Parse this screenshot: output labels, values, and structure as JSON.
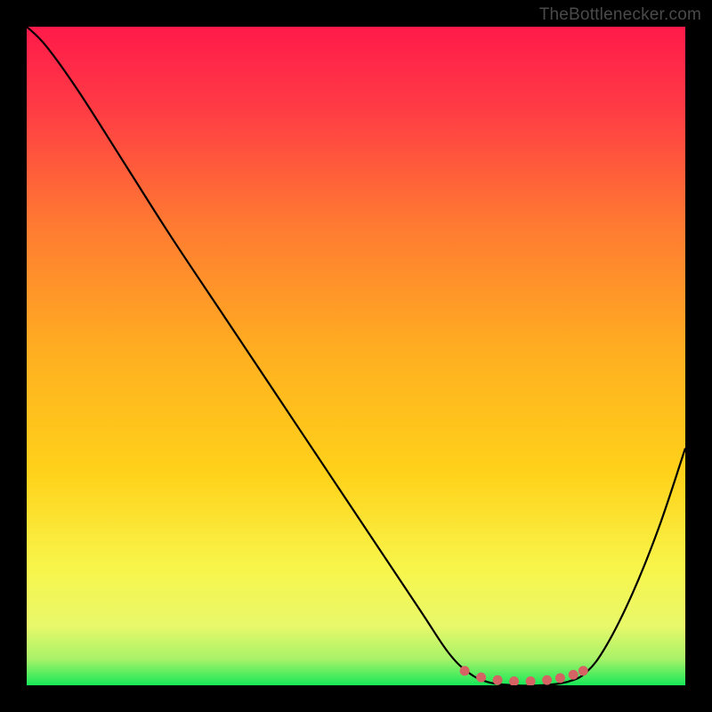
{
  "watermark": "TheBottlenecker.com",
  "colors": {
    "background": "#000000",
    "curve": "#000000",
    "marker": "#d66363",
    "gradient_top": "#ff1a4a",
    "gradient_mid_upper": "#ff8030",
    "gradient_mid": "#ffd21a",
    "gradient_mid_lower": "#f8fa5a",
    "gradient_bottom": "#17e858"
  },
  "chart_data": {
    "type": "line",
    "title": "",
    "xlabel": "",
    "ylabel": "",
    "xlim": [
      0,
      100
    ],
    "ylim": [
      0,
      100
    ],
    "curve": [
      {
        "x": 0,
        "y": 100
      },
      {
        "x": 3,
        "y": 97
      },
      {
        "x": 8,
        "y": 90
      },
      {
        "x": 15,
        "y": 79
      },
      {
        "x": 22,
        "y": 68
      },
      {
        "x": 30,
        "y": 56
      },
      {
        "x": 38,
        "y": 44
      },
      {
        "x": 46,
        "y": 32
      },
      {
        "x": 54,
        "y": 20
      },
      {
        "x": 60,
        "y": 11
      },
      {
        "x": 64,
        "y": 5
      },
      {
        "x": 67,
        "y": 2
      },
      {
        "x": 70,
        "y": 0.5
      },
      {
        "x": 74,
        "y": 0
      },
      {
        "x": 78,
        "y": 0
      },
      {
        "x": 82,
        "y": 0.5
      },
      {
        "x": 85,
        "y": 2
      },
      {
        "x": 88,
        "y": 6
      },
      {
        "x": 92,
        "y": 14
      },
      {
        "x": 96,
        "y": 24
      },
      {
        "x": 100,
        "y": 36
      }
    ],
    "optimal_markers": [
      {
        "x": 66.5,
        "y": 2.2
      },
      {
        "x": 69,
        "y": 1.2
      },
      {
        "x": 71.5,
        "y": 0.8
      },
      {
        "x": 74,
        "y": 0.6
      },
      {
        "x": 76.5,
        "y": 0.6
      },
      {
        "x": 79,
        "y": 0.8
      },
      {
        "x": 81,
        "y": 1.1
      },
      {
        "x": 83,
        "y": 1.6
      },
      {
        "x": 84.5,
        "y": 2.2
      }
    ],
    "annotations": []
  }
}
